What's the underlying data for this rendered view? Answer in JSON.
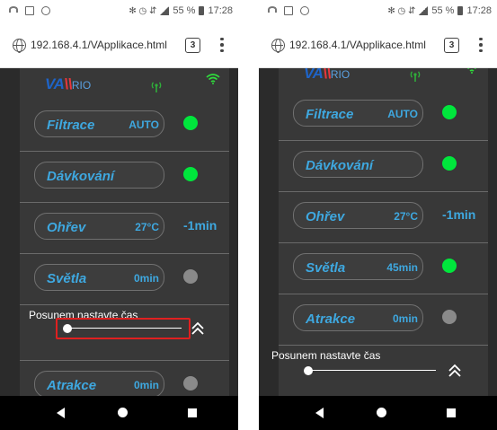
{
  "screens": [
    {
      "status": {
        "icons": [
          "wifi-icon",
          "image-icon",
          "circle-icon"
        ],
        "right_symbols": "✻ ◷ ⇵",
        "battery": "55 %",
        "time": "17:28"
      },
      "browser": {
        "url": "192.168.4.1/VApplikace.html",
        "tab_count": "3"
      },
      "app": {
        "logo": {
          "a": "VA",
          "b": "\\\\",
          "c": "RIO"
        },
        "rows": [
          {
            "label": "Filtrace",
            "value": "AUTO",
            "status": "on",
            "status_color": "#00e63c"
          },
          {
            "label": "Dávkování",
            "value": "",
            "status": "on",
            "status_color": "#00e63c"
          },
          {
            "label": "Ohřev",
            "value": "27°C",
            "timer": "-1min"
          },
          {
            "label": "Světla",
            "value": "0min",
            "status": "off",
            "status_color": "#8a8a8a"
          },
          {
            "label": "Atrakce",
            "value": "0min",
            "status": "off",
            "status_color": "#8a8a8a"
          }
        ],
        "slider": {
          "label": "Posunem nastavte čas",
          "value_fraction": 0.0,
          "highlighted": true,
          "highlight_color": "#e02020"
        }
      }
    },
    {
      "status": {
        "icons": [
          "wifi-icon",
          "image-icon",
          "circle-icon"
        ],
        "right_symbols": "✻ ◷ ⇵",
        "battery": "55 %",
        "time": "17:28"
      },
      "browser": {
        "url": "192.168.4.1/VApplikace.html",
        "tab_count": "3"
      },
      "app": {
        "logo": {
          "a": "VA",
          "b": "\\\\",
          "c": "RIO"
        },
        "rows": [
          {
            "label": "Filtrace",
            "value": "AUTO",
            "status": "on",
            "status_color": "#00e63c"
          },
          {
            "label": "Dávkování",
            "value": "",
            "status": "on",
            "status_color": "#00e63c"
          },
          {
            "label": "Ohřev",
            "value": "27°C",
            "timer": "-1min"
          },
          {
            "label": "Světla",
            "value": "45min",
            "status": "on",
            "status_color": "#00e63c"
          },
          {
            "label": "Atrakce",
            "value": "0min",
            "status": "off",
            "status_color": "#8a8a8a"
          }
        ],
        "slider": {
          "label": "Posunem nastavte čas",
          "value_fraction": 0.0,
          "highlighted": false
        }
      }
    }
  ],
  "colors": {
    "accent": "#3ea8e0",
    "status_on": "#00e63c",
    "status_off": "#8a8a8a",
    "panel": "#383838",
    "logo_blue": "#1e64c8",
    "logo_red": "#e8373c"
  }
}
